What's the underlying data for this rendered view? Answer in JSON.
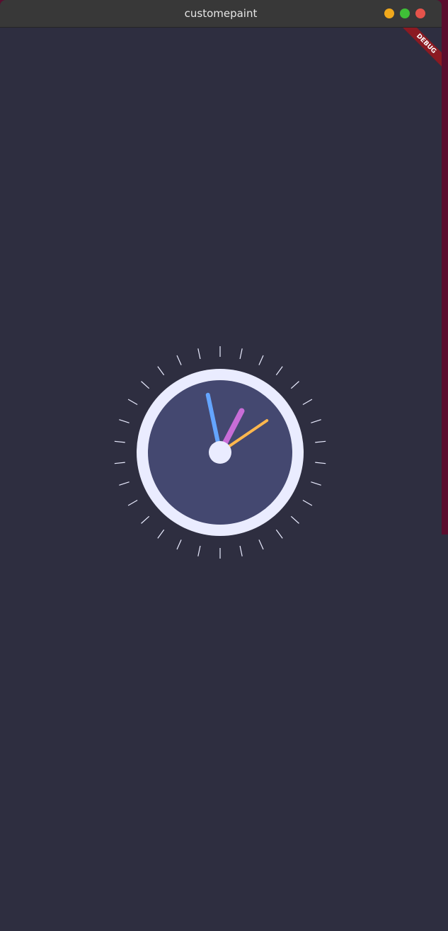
{
  "window": {
    "title": "customepaint",
    "buttons": {
      "minimize_color": "#f0a81c",
      "maximize_color": "#3fbf37",
      "close_color": "#e5534b"
    }
  },
  "debug_banner": {
    "label": "DEBUG"
  },
  "clock": {
    "face_color": "#444870",
    "rim_color": "#eaecff",
    "center_color": "#eaecff",
    "tick_color": "#eaecff",
    "hands": {
      "hour_color": "#c86dd7",
      "minute_color": "#ffb74d",
      "second_color": "#64a5ff"
    },
    "time": {
      "hour": 12,
      "minute": 5,
      "second": 58
    },
    "tick_count": 30
  }
}
